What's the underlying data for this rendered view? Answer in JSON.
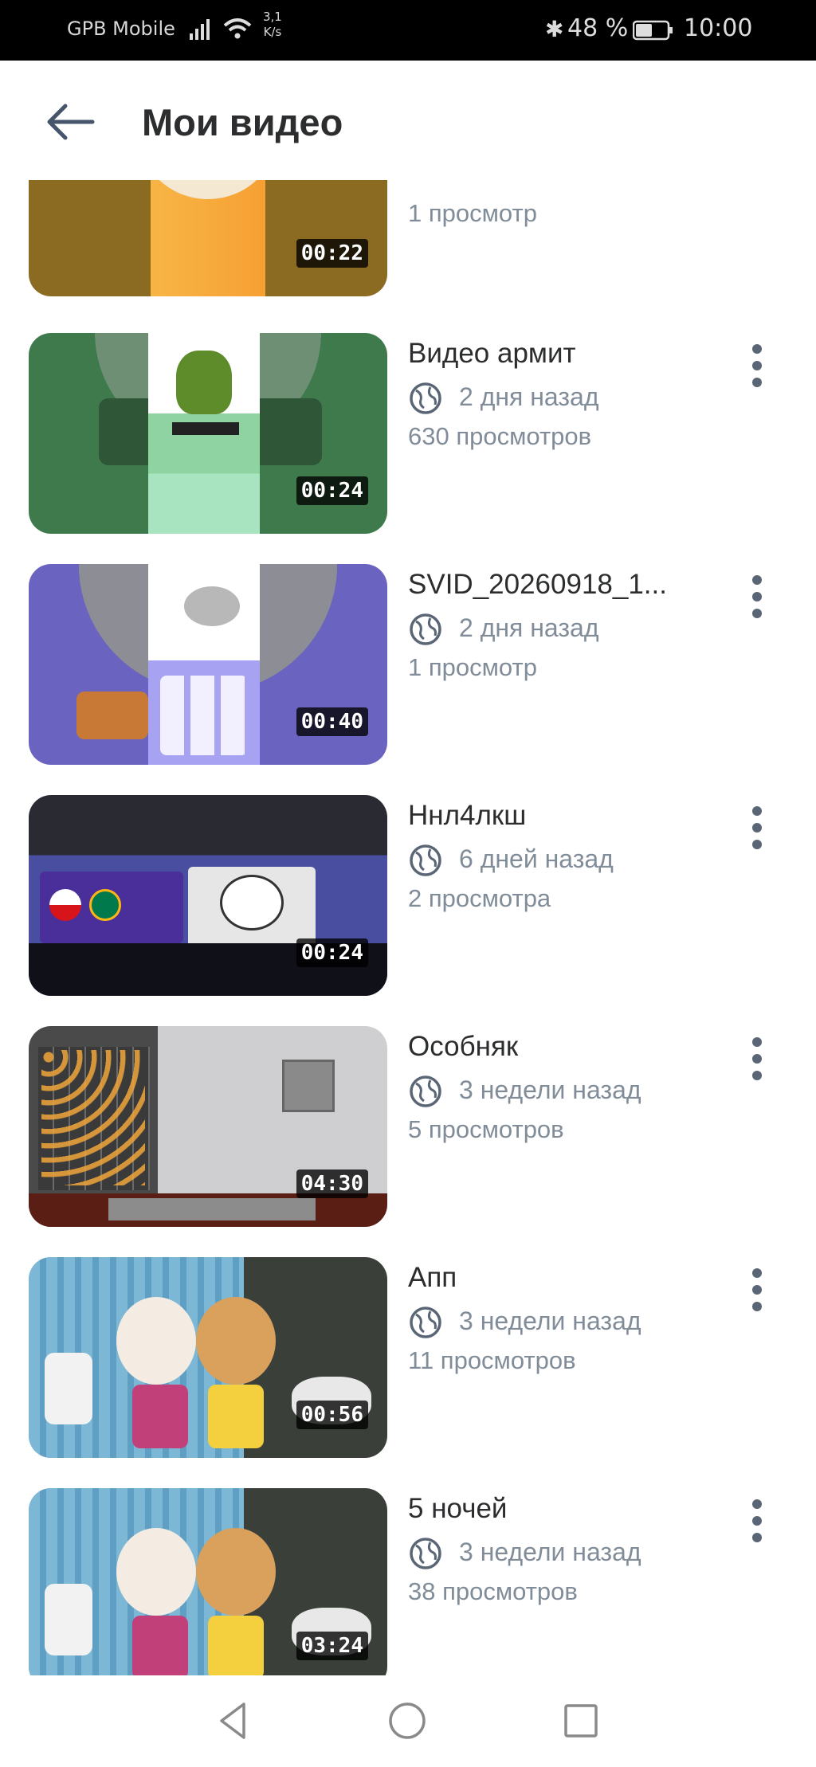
{
  "status_bar": {
    "carrier": "GPB Mobile",
    "speed_value": "3,1",
    "speed_unit": "K/s",
    "battery": "48 %",
    "time": "10:00"
  },
  "header": {
    "title": "Мои видео"
  },
  "videos": [
    {
      "title": "",
      "date": "",
      "views": "1 просмотр",
      "duration": "00:22"
    },
    {
      "title": "Видео армит",
      "date": "2 дня назад",
      "views": "630 просмотров",
      "duration": "00:24"
    },
    {
      "title": "SVID_20260918_1...",
      "date": "2 дня назад",
      "views": "1 просмотр",
      "duration": "00:40"
    },
    {
      "title": "Ннл4лкш",
      "date": "6 дней назад",
      "views": "2 просмотра",
      "duration": "00:24"
    },
    {
      "title": "Особняк",
      "date": "3 недели назад",
      "views": "5 просмотров",
      "duration": "04:30"
    },
    {
      "title": "Апп",
      "date": "3 недели назад",
      "views": "11 просмотров",
      "duration": "00:56"
    },
    {
      "title": "5 ночей",
      "date": "3 недели назад",
      "views": "38 просмотров",
      "duration": "03:24"
    }
  ],
  "colors": {
    "text_primary": "#2c2d2e",
    "text_secondary": "#818c99",
    "icon": "#5a6676"
  },
  "icons": {
    "back": "arrow-left-icon",
    "visibility": "globe-icon",
    "more": "more-vertical-icon"
  }
}
